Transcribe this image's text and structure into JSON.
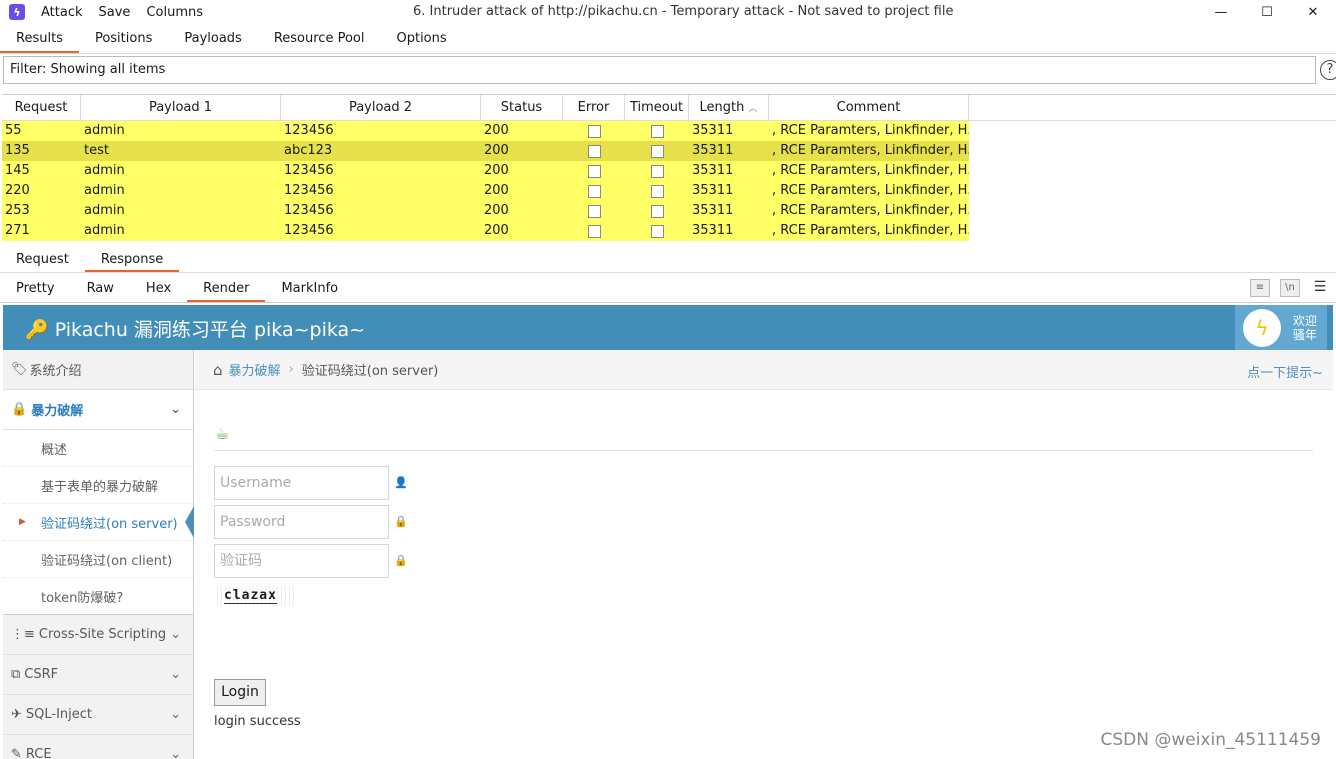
{
  "titlebar": {
    "menu": [
      "Attack",
      "Save",
      "Columns"
    ],
    "title": "6. Intruder attack of http://pikachu.cn - Temporary attack - Not saved to project file",
    "controls": [
      "—",
      "☐",
      "✕"
    ]
  },
  "tabs_main": [
    "Results",
    "Positions",
    "Payloads",
    "Resource Pool",
    "Options"
  ],
  "filter": "Filter: Showing all items",
  "table": {
    "columns": [
      "Request",
      "Payload 1",
      "Payload 2",
      "Status",
      "Error",
      "Timeout",
      "Length",
      "Comment"
    ],
    "rows": [
      {
        "req": "55",
        "p1": "admin",
        "p2": "123456",
        "status": "200",
        "len": "35311",
        "comment": ", RCE Paramters, Linkfinder, H..."
      },
      {
        "req": "135",
        "p1": "test",
        "p2": "abc123",
        "status": "200",
        "len": "35311",
        "comment": ", RCE Paramters, Linkfinder, H..."
      },
      {
        "req": "145",
        "p1": "admin",
        "p2": "123456",
        "status": "200",
        "len": "35311",
        "comment": ", RCE Paramters, Linkfinder, H..."
      },
      {
        "req": "220",
        "p1": "admin",
        "p2": "123456",
        "status": "200",
        "len": "35311",
        "comment": ", RCE Paramters, Linkfinder, H..."
      },
      {
        "req": "253",
        "p1": "admin",
        "p2": "123456",
        "status": "200",
        "len": "35311",
        "comment": ", RCE Paramters, Linkfinder, H..."
      },
      {
        "req": "271",
        "p1": "admin",
        "p2": "123456",
        "status": "200",
        "len": "35311",
        "comment": ", RCE Paramters, Linkfinder, H..."
      }
    ]
  },
  "tabs_msg": [
    "Request",
    "Response"
  ],
  "tabs_view": [
    "Pretty",
    "Raw",
    "Hex",
    "Render",
    "MarkInfo"
  ],
  "page": {
    "brand": "Pikachu 漏洞练习平台 pika~pika~",
    "welcome": [
      "欢迎",
      "骚年"
    ],
    "sidebar": {
      "intro": "系统介绍",
      "brute": "暴力破解",
      "subs": [
        "概述",
        "基于表单的暴力破解",
        "验证码绕过(on server)",
        "验证码绕过(on client)",
        "token防爆破?"
      ],
      "others": [
        "Cross-Site Scripting",
        "CSRF",
        "SQL-Inject",
        "RCE"
      ]
    },
    "crumb": {
      "parent": "暴力破解",
      "current": "验证码绕过(on server)"
    },
    "hint": "点一下提示~",
    "form": {
      "username": "Username",
      "password": "Password",
      "code": "验证码",
      "captcha": "clazax",
      "login": "Login",
      "message": "login success"
    }
  },
  "watermark": "CSDN @weixin_45111459",
  "colors": {
    "row": "#ffff66",
    "row_selected": "#e6e04a",
    "accent": "#e8642c",
    "header": "#438eb9"
  }
}
